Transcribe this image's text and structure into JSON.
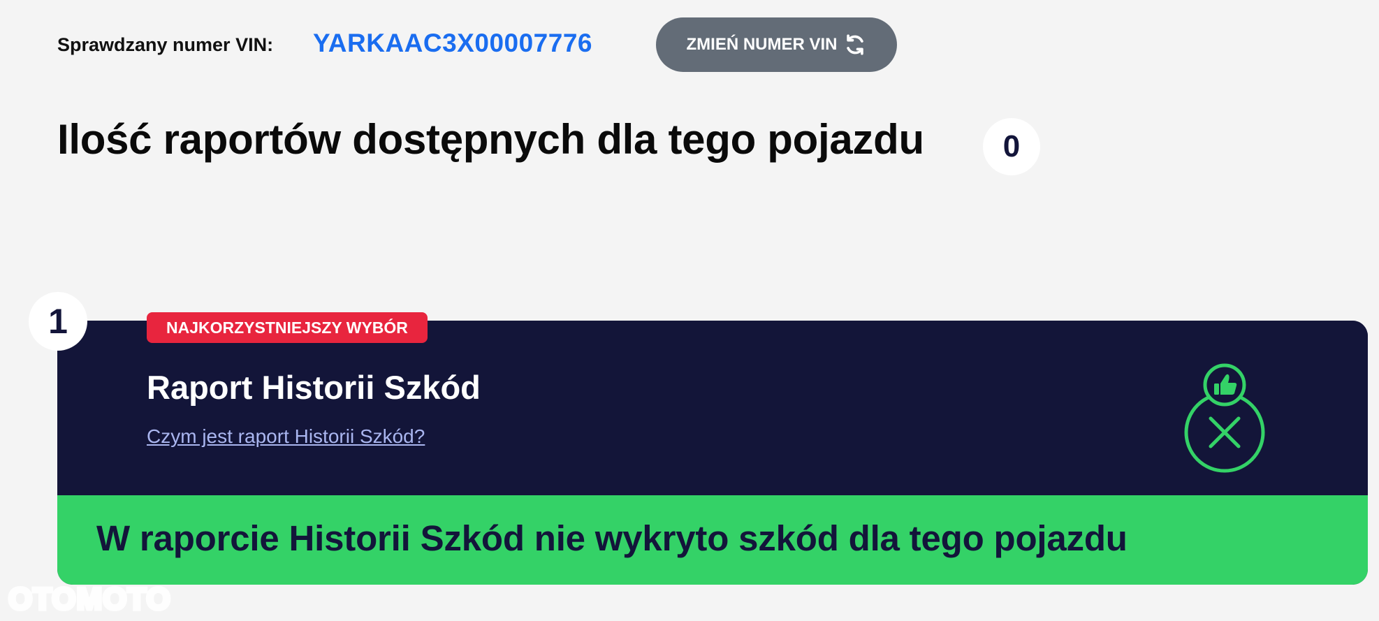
{
  "vin": {
    "label": "Sprawdzany numer VIN:",
    "value": "YARKAAC3X00007776",
    "change_button": "ZMIEŃ NUMER VIN",
    "change_icon": "refresh-icon"
  },
  "reports": {
    "headline": "Ilość raportów dostępnych dla tego pojazdu",
    "count": "0"
  },
  "card": {
    "number": "1",
    "badge": "NAJKORZYSTNIEJSZY WYBÓR",
    "title": "Raport Historii Szkód",
    "link": "Czym jest raport Historii Szkód?",
    "status_icons": [
      "thumbs-up-icon",
      "x-circle-icon"
    ],
    "result": "W raporcie Historii Szkód nie wykryto szkód dla tego pojazdu"
  },
  "watermark": {
    "text": "OTOMOTO"
  },
  "colors": {
    "background": "#f4f4f4",
    "vin_blue": "#1a6df0",
    "button_gray": "#636c77",
    "navy": "#131539",
    "green": "#34d267",
    "badge_red": "#e8253e",
    "link": "#aab6f0"
  }
}
